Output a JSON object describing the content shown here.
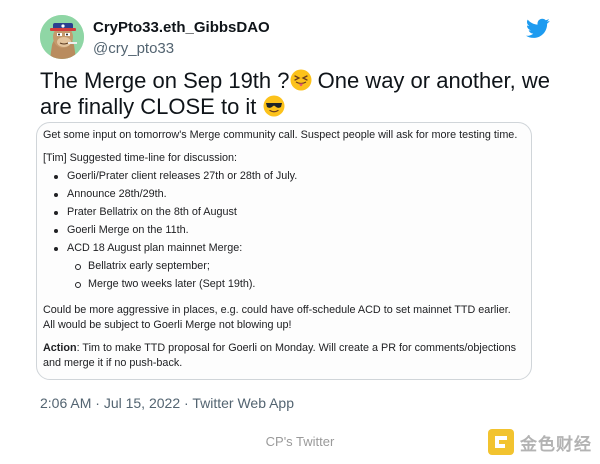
{
  "author": {
    "display_name": "CryPto33.eth_GibbsDAO",
    "handle": "@cry_pto33"
  },
  "tweet": {
    "text_part1": "The Merge on Sep 19th ?",
    "text_part2": " One way or another, we are finally CLOSE to it "
  },
  "document": {
    "intro": "Get some input on tomorrow's Merge community call. Suspect people will ask for more testing time.",
    "timeline_heading": "[Tim] Suggested time-line for discussion:",
    "bullets": [
      "Goerli/Prater client releases 27th or 28th of July.",
      "Announce 28th/29th.",
      "Prater Bellatrix on the 8th of August",
      "Goerli Merge on the 11th.",
      "ACD 18 August plan mainnet Merge:"
    ],
    "sub_bullets": [
      "Bellatrix early september;",
      "Merge two weeks later (Sept 19th)."
    ],
    "paragraph": "Could be more aggressive in places, e.g. could have off-schedule ACD to set mainnet TTD earlier. All would be subject to Goerli Merge not blowing up!",
    "action_label": "Action",
    "action_text": ": Tim to make TTD proposal for Goerli on Monday. Will create a PR for comments/objections and merge it if no push-back."
  },
  "meta": {
    "time": "2:06 AM",
    "separator": " · ",
    "date": "Jul 15, 2022",
    "source": "Twitter Web App"
  },
  "caption": "CP's Twitter",
  "watermark": {
    "text": "金色财经"
  },
  "icons": {
    "avatar": "bored-ape-avatar",
    "logo": "twitter-bird-icon",
    "emoji1": "squinting-tongue-emoji",
    "emoji2": "sunglasses-emoji"
  },
  "colors": {
    "twitter_blue": "#1d9bf0",
    "secondary_text": "#536471"
  }
}
